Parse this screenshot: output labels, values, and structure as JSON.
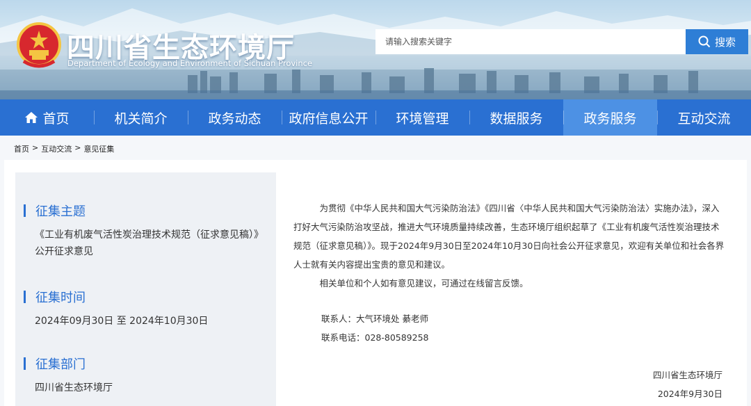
{
  "header": {
    "title": "四川省生态环境厅",
    "subtitle": "Department of Ecology and Environment of Sichuan Province",
    "search_placeholder": "请输入搜索关键字",
    "search_button": "搜索"
  },
  "nav": {
    "items": [
      {
        "label": "首页"
      },
      {
        "label": "机关简介"
      },
      {
        "label": "政务动态"
      },
      {
        "label": "政府信息公开"
      },
      {
        "label": "环境管理"
      },
      {
        "label": "数据服务"
      },
      {
        "label": "政务服务"
      },
      {
        "label": "互动交流"
      }
    ],
    "active": "政务服务"
  },
  "breadcrumb": {
    "items": [
      "首页",
      "互动交流",
      "意见征集"
    ],
    "separator": ">"
  },
  "sidebar": {
    "topic_title": "征集主题",
    "topic_text": "《工业有机废气活性炭治理技术规范（征求意见稿）》公开征求意见",
    "time_title": "征集时间",
    "time_text": "2024年09月30日 至 2024年10月30日",
    "dept_title": "征集部门",
    "dept_text": "四川省生态环境厅"
  },
  "article": {
    "para1": "为贯彻《中华人民共和国大气污染防治法》《四川省〈中华人民共和国大气污染防治法〉实施办法》，深入打好大气污染防治攻坚战，推进大气环境质量持续改善，生态环境厅组织起草了《工业有机废气活性炭治理技术规范（征求意见稿）》。现于2024年9月30日至2024年10月30日向社会公开征求意见，欢迎有关单位和社会各界人士就有关内容提出宝贵的意见和建议。",
    "para2": "相关单位和个人如有意见建议，可通过在线留言反馈。",
    "contact_person": "联系人：大气环境处  綦老师",
    "contact_phone": "联系电话：028-80589258",
    "sign_org": "四川省生态环境厅",
    "sign_date": "2024年9月30日"
  },
  "colors": {
    "nav": "#2a70d2",
    "nav_active": "#4d91e4",
    "accent": "#2e7ed6"
  }
}
